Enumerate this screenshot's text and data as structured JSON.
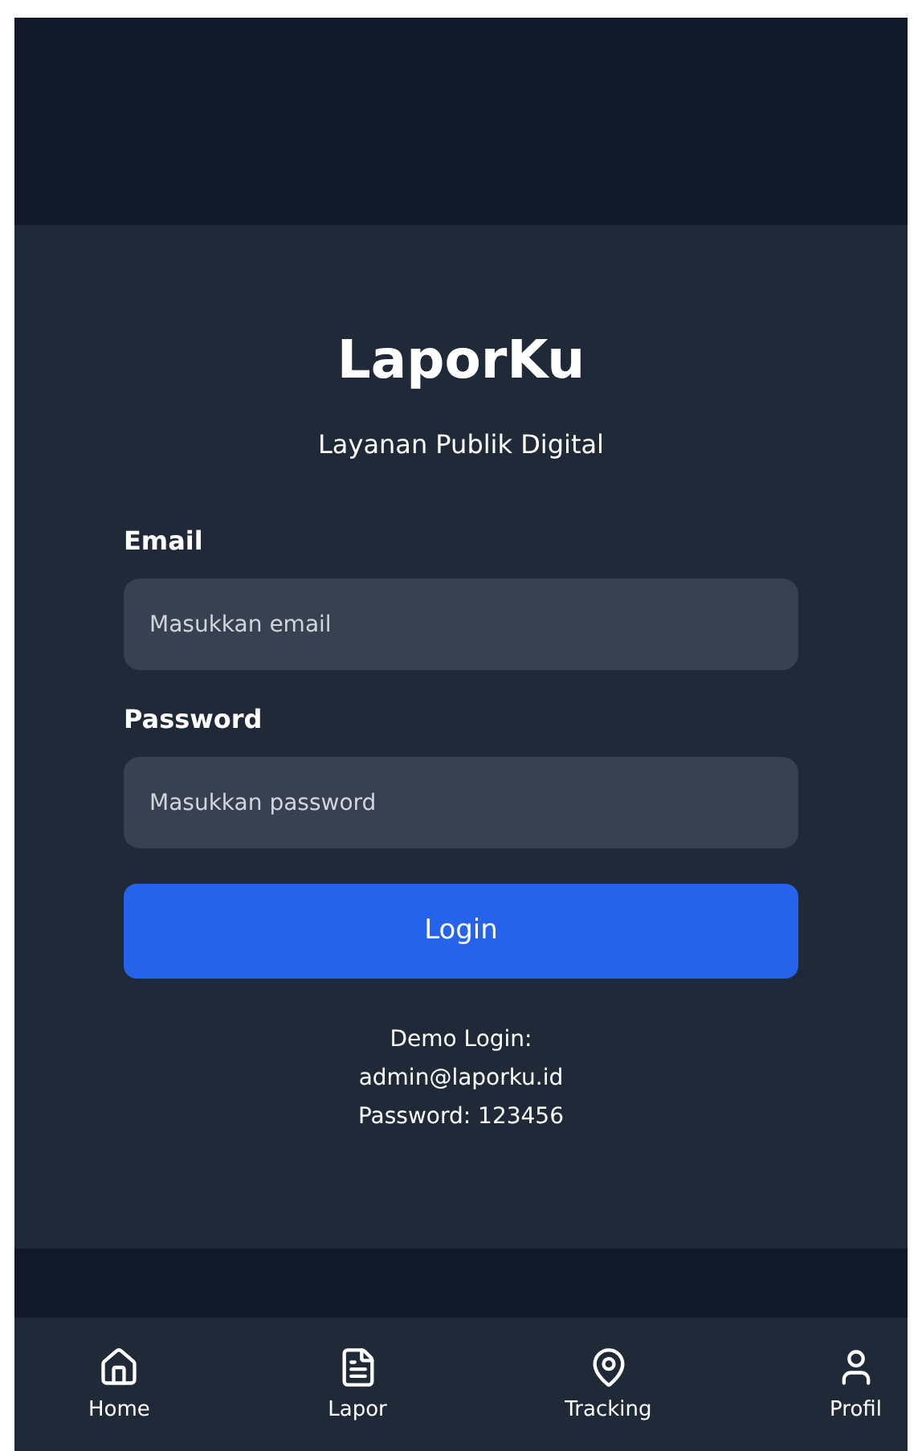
{
  "app": {
    "title": "LaporKu",
    "subtitle": "Layanan Publik Digital"
  },
  "form": {
    "fields": [
      {
        "label": "Email",
        "placeholder": "Masukkan email"
      },
      {
        "label": "Password",
        "placeholder": "Masukkan password"
      }
    ],
    "submit": "Login",
    "demo_lines": [
      "Demo Login:",
      "admin@laporku.id",
      "Password: 123456"
    ]
  },
  "nav": [
    {
      "label": "Home"
    },
    {
      "label": "Lapor"
    },
    {
      "label": "Tracking"
    },
    {
      "label": "Profil"
    }
  ]
}
